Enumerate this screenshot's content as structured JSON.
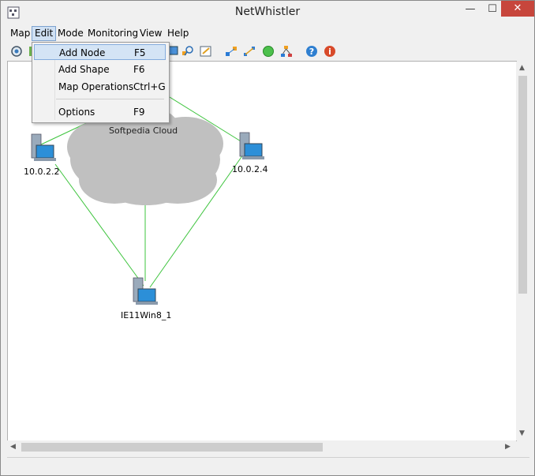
{
  "window": {
    "title": "NetWhistler",
    "controls": {
      "minimize": "—",
      "maximize": "☐",
      "close": "✕"
    }
  },
  "menubar": {
    "items": [
      {
        "label": "Map"
      },
      {
        "label": "Edit"
      },
      {
        "label": "Mode"
      },
      {
        "label": "Monitoring"
      },
      {
        "label": "View"
      },
      {
        "label": "Help"
      }
    ]
  },
  "edit_menu": {
    "items": [
      {
        "label": "Add Node",
        "shortcut": "F5"
      },
      {
        "label": "Add Shape",
        "shortcut": "F6"
      },
      {
        "label": "Map Operations",
        "shortcut": "Ctrl+G"
      },
      {
        "label": "Options",
        "shortcut": "F9"
      }
    ]
  },
  "map": {
    "cloud_label": "Softpedia Cloud",
    "nodes": [
      {
        "label": "10.0.2.2"
      },
      {
        "label": "10.0.2.4"
      },
      {
        "label": "IE11Win8_1"
      }
    ],
    "link_color": "#3ec43e"
  },
  "colors": {
    "close_button": "#c7463c",
    "menu_highlight": "#d4e4f5"
  }
}
